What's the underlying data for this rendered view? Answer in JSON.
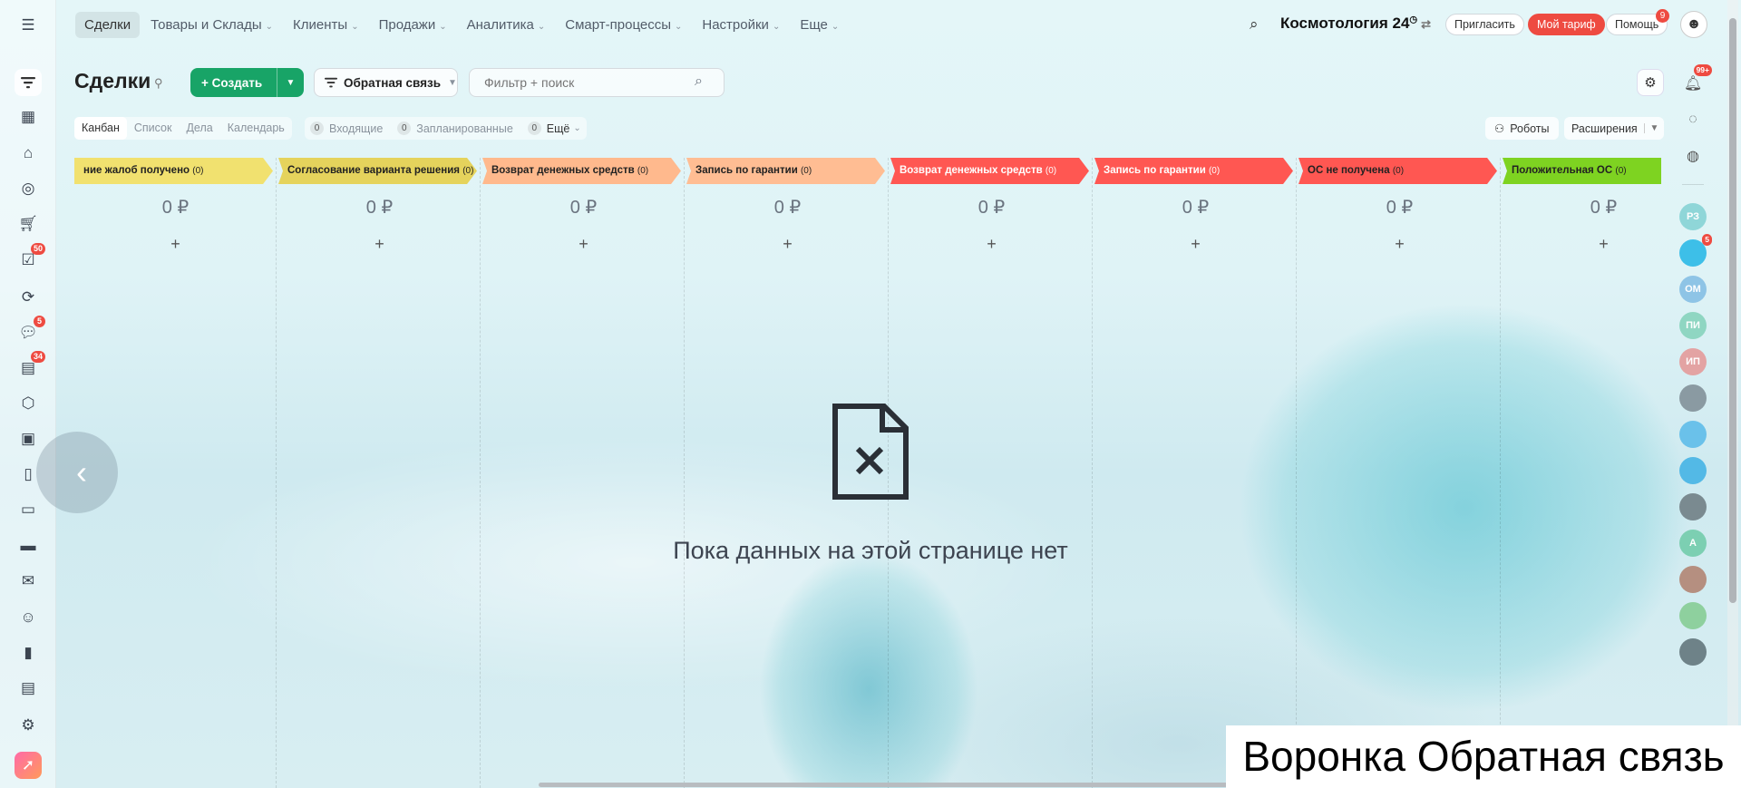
{
  "nav": {
    "items": [
      {
        "label": "Сделки",
        "active": true,
        "caret": false
      },
      {
        "label": "Товары и Склады",
        "caret": true
      },
      {
        "label": "Клиенты",
        "caret": true
      },
      {
        "label": "Продажи",
        "caret": true
      },
      {
        "label": "Аналитика",
        "caret": true
      },
      {
        "label": "Смарт-процессы",
        "caret": true
      },
      {
        "label": "Настройки",
        "caret": true
      },
      {
        "label": "Еще",
        "caret": true
      }
    ],
    "brand": "Космотология 24",
    "invite": "Пригласить",
    "tariff": "Мой тариф",
    "help": "Помощь",
    "help_badge": "9"
  },
  "leftbar": {
    "badges": {
      "tasks": "50",
      "chat": "5",
      "feed": "34"
    }
  },
  "header": {
    "title": "Сделки",
    "create": "Создать",
    "funnel": "Обратная связь",
    "filter_placeholder": "Фильтр + поиск"
  },
  "views": {
    "items": [
      "Канбан",
      "Список",
      "Дела",
      "Календарь"
    ],
    "counters": [
      {
        "n": "0",
        "label": "Входящие"
      },
      {
        "n": "0",
        "label": "Запланированные"
      },
      {
        "n": "0",
        "label": "Ещё"
      }
    ],
    "robots": "Роботы",
    "extensions": "Расширения"
  },
  "stages": [
    {
      "name": "ние жалоб получено",
      "count": "(0)",
      "color": "#f1e16f",
      "text": "dark",
      "sum": "0 ₽"
    },
    {
      "name": "Согласование варианта решения",
      "count": "(0)",
      "color": "#e5d35c",
      "text": "dark",
      "sum": "0 ₽"
    },
    {
      "name": "Возврат денежных средств",
      "count": "(0)",
      "color": "#ffb98d",
      "text": "dark",
      "sum": "0 ₽"
    },
    {
      "name": "Запись по гарантии",
      "count": "(0)",
      "color": "#ffbd93",
      "text": "dark",
      "sum": "0 ₽"
    },
    {
      "name": "Возврат денежных средств",
      "count": "(0)",
      "color": "#ff5752",
      "text": "light",
      "sum": "0 ₽"
    },
    {
      "name": "Запись по гарантии",
      "count": "(0)",
      "color": "#ff5752",
      "text": "light",
      "sum": "0 ₽"
    },
    {
      "name": "ОС не получена",
      "count": "(0)",
      "color": "#ff5752",
      "text": "dark",
      "sum": "0 ₽"
    },
    {
      "name": "Положительная ОС",
      "count": "(0)",
      "color": "#7ed321",
      "text": "dark",
      "sum": "0 ₽"
    }
  ],
  "empty": {
    "message": "Пока данных на этой странице нет"
  },
  "rightbar": {
    "bell_badge": "99+",
    "avatars": [
      {
        "initials": "РЗ",
        "color": "#8fd6d8"
      },
      {
        "initials": "",
        "color": "#3dbfe8",
        "badge": "5"
      },
      {
        "initials": "ОМ",
        "color": "#8ec4e6"
      },
      {
        "initials": "ПИ",
        "color": "#8fd6c2"
      },
      {
        "initials": "ИП",
        "color": "#e3a3a3"
      },
      {
        "initials": "",
        "color": "#8a9aa2"
      },
      {
        "initials": "",
        "color": "#6ac1ea"
      },
      {
        "initials": "",
        "color": "#53b9e6"
      },
      {
        "initials": "",
        "color": "#7a8a90"
      },
      {
        "initials": "А",
        "color": "#7ccfb2"
      },
      {
        "initials": "",
        "color": "#b58f80"
      },
      {
        "initials": "",
        "color": "#8ed09e"
      },
      {
        "initials": "",
        "color": "#6e8288"
      }
    ]
  },
  "caption": "Воронка Обратная связь"
}
